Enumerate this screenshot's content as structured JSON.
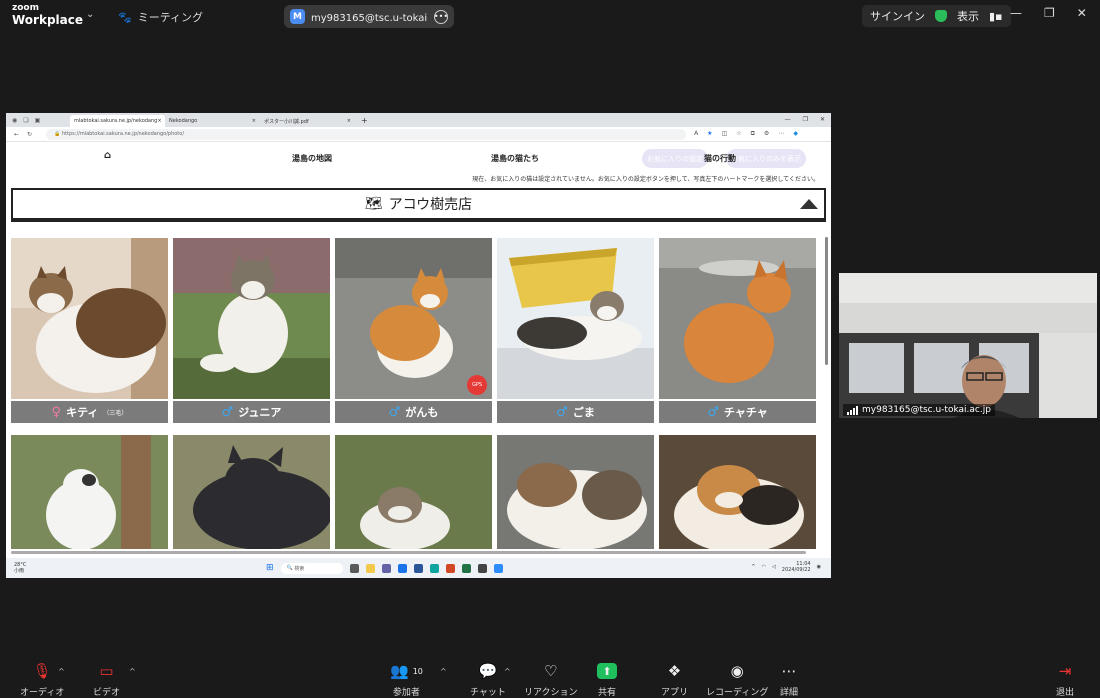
{
  "zoom_top": {
    "logo_line1": "zoom",
    "logo_line2": "Workplace",
    "meeting_label": "ミーティング",
    "account_badge": "M",
    "account_text": "my983165@tsc.u-tokai.ac.jp さん",
    "signin": "サインイン",
    "view": "表示"
  },
  "browser": {
    "tabs": [
      {
        "label": "mlabtokai.sakura.ne.jp/nekodang"
      },
      {
        "label": "Nekodango"
      },
      {
        "label": "ポスター小川誠.pdf"
      }
    ],
    "url_host": "https://mlabtokai.sakura.ne.jp",
    "url_path": "/nekodango/photo/"
  },
  "site": {
    "nav": {
      "map": "湯島の地図",
      "cats": "湯島の猫たち",
      "behavior": "猫の行動",
      "fav_setting": "お気に入りの設定",
      "fav_show": "お気に入りのみを表示"
    },
    "notice": "現在、お気に入りの猫は設定されていません。お気に入りの設定ボタンを押して、写真左下のハートマークを選択してください。",
    "store_title": "アコウ樹売店",
    "cats": [
      {
        "name": "キティ",
        "sub": "（三毛）",
        "sex": "♀"
      },
      {
        "name": "ジュニア",
        "sub": "",
        "sex": "♂"
      },
      {
        "name": "がんも",
        "sub": "",
        "sex": "♂"
      },
      {
        "name": "ごま",
        "sub": "",
        "sex": "♂"
      },
      {
        "name": "チャチャ",
        "sub": "",
        "sex": "♂"
      }
    ],
    "gps_label": "GPS"
  },
  "taskbar": {
    "temp": "28°C",
    "weather": "小雨",
    "search": "検索",
    "time": "11:04",
    "date": "2024/09/22"
  },
  "video": {
    "participant": "my983165@tsc.u-tokai.ac.jp"
  },
  "zoom_bottom": {
    "audio": "オーディオ",
    "video": "ビデオ",
    "participants": "参加者",
    "participants_count": "10",
    "chat": "チャット",
    "reactions": "リアクション",
    "share": "共有",
    "apps": "アプリ",
    "recording": "レコーディング",
    "more": "詳細",
    "leave": "退出"
  },
  "colors": {
    "zoom_bg": "#1a1a1a",
    "share_green": "#1fbf5e",
    "male_blue": "#3da7f0",
    "female_pink": "#f07aa0",
    "name_bar": "#7b7b7b",
    "fav_btn": "#e7e4f5"
  }
}
